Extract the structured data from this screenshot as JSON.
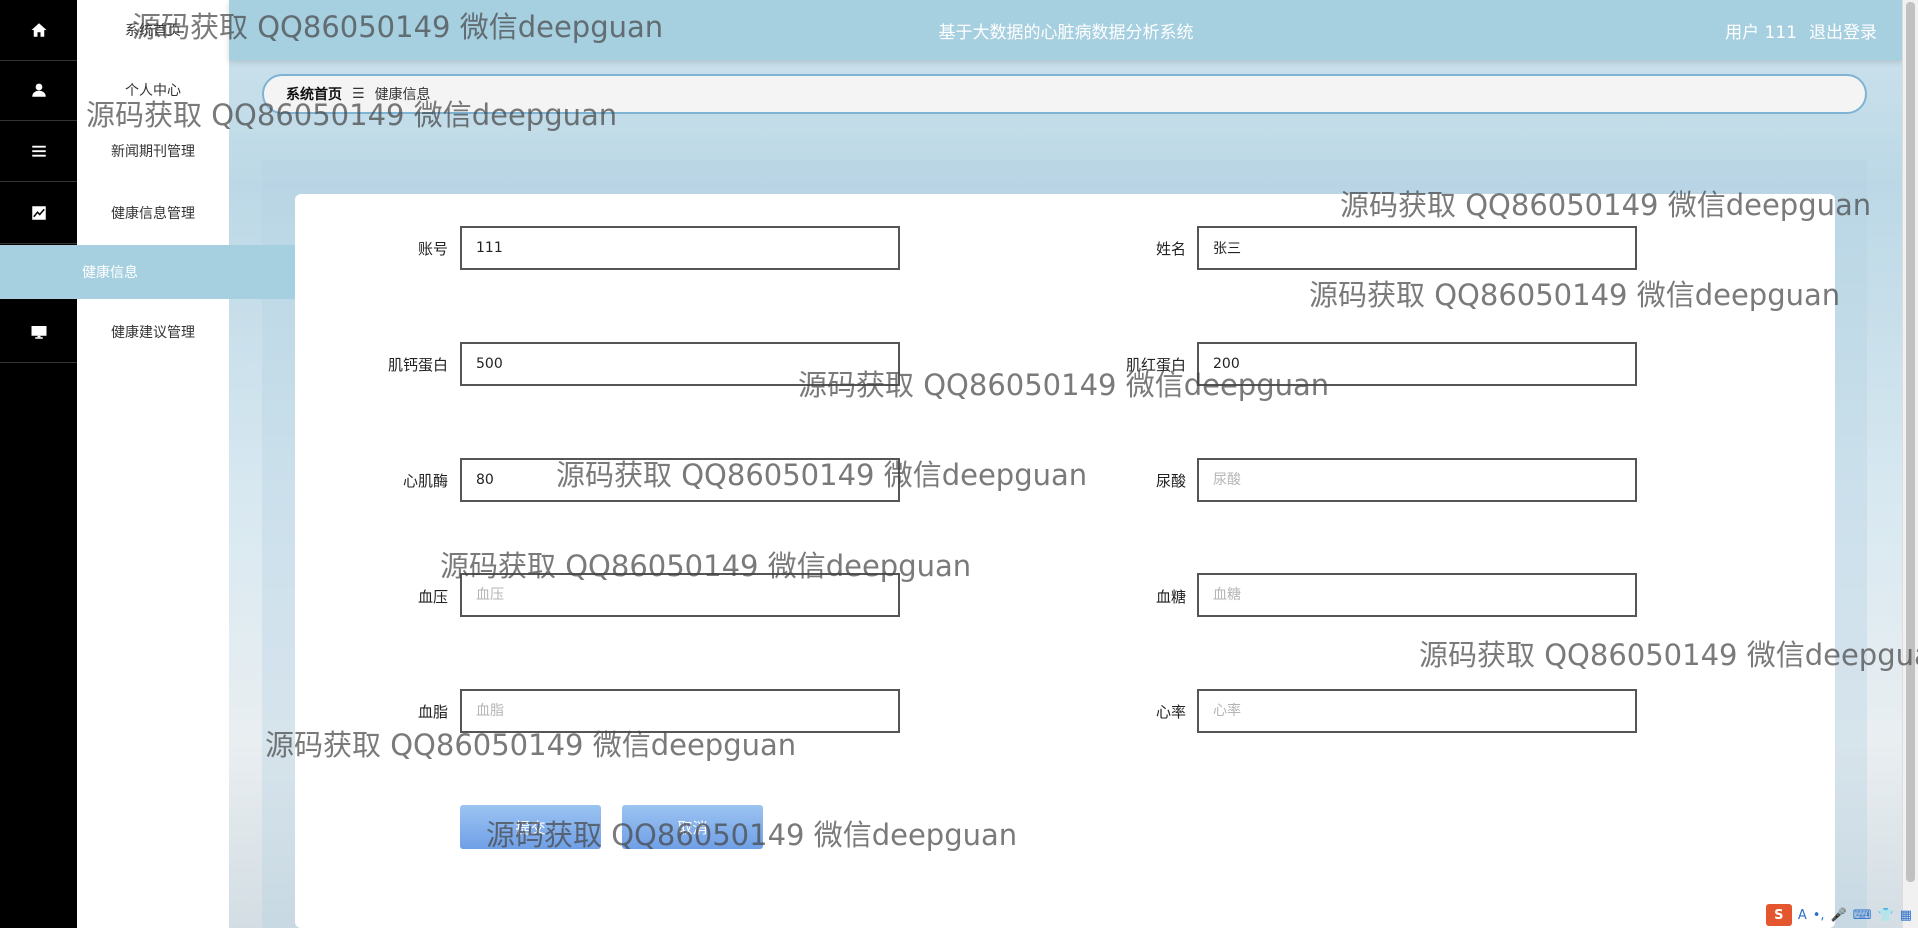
{
  "sidebar": {
    "items": [
      {
        "label": "系统首页",
        "icon": "home-icon"
      },
      {
        "label": "个人中心",
        "icon": "user-icon"
      },
      {
        "label": "新闻期刊管理",
        "icon": "list-icon"
      },
      {
        "label": "健康信息管理",
        "icon": "chart-icon"
      },
      {
        "label": "健康信息",
        "icon": ""
      },
      {
        "label": "健康建议管理",
        "icon": "monitor-icon"
      }
    ],
    "active_color": "#a6cfe0"
  },
  "header": {
    "title": "基于大数据的心脏病数据分析系统",
    "user": "用户 111",
    "logout": "退出登录",
    "color": "#a6cfe0"
  },
  "breadcrumb": {
    "home": "系统首页",
    "separator": "☰",
    "current": "健康信息"
  },
  "form": {
    "fields": [
      {
        "label": "账号",
        "value": "111",
        "placeholder": "账号"
      },
      {
        "label": "姓名",
        "value": "张三",
        "placeholder": "姓名"
      },
      {
        "label": "肌钙蛋白",
        "value": "500",
        "placeholder": "肌钙蛋白"
      },
      {
        "label": "肌红蛋白",
        "value": "200",
        "placeholder": "肌红蛋白"
      },
      {
        "label": "心肌酶",
        "value": "80",
        "placeholder": "心肌酶"
      },
      {
        "label": "尿酸",
        "value": "",
        "placeholder": "尿酸"
      },
      {
        "label": "血压",
        "value": "",
        "placeholder": "血压"
      },
      {
        "label": "血糖",
        "value": "",
        "placeholder": "血糖"
      },
      {
        "label": "血脂",
        "value": "",
        "placeholder": "血脂"
      },
      {
        "label": "心率",
        "value": "",
        "placeholder": "心率"
      }
    ],
    "buttons": {
      "submit": "提交",
      "cancel": "取消"
    },
    "button_color": "#7aa8ea"
  },
  "watermark": "源码获取 QQ86050149 微信deepguan",
  "tray": {
    "ime_logo": "S",
    "ime_lang": "A"
  }
}
